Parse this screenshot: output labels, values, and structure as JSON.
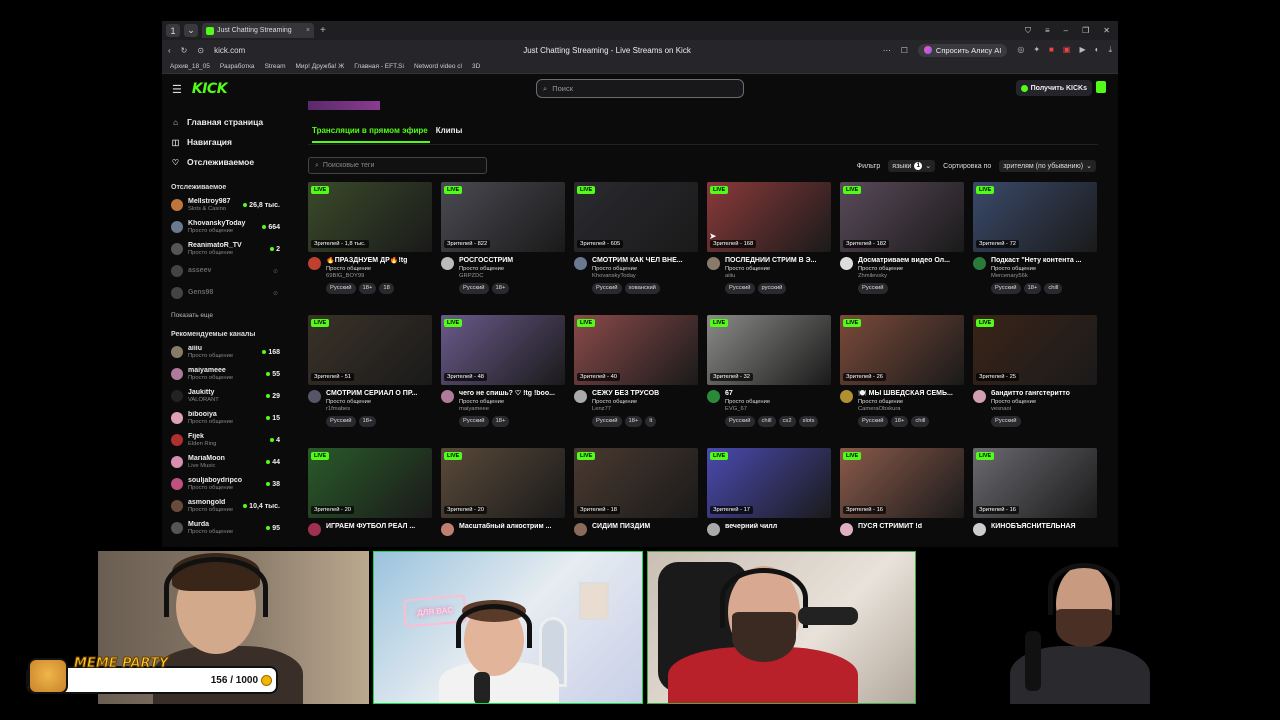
{
  "browser": {
    "tab_title": "Just Chatting Streaming",
    "url": "kick.com",
    "page_title": "Just Chatting Streaming - Live Streams on Kick",
    "alice_label": "Спросить Алису AI",
    "bookmarks": [
      "Архив_18_05",
      "Разработка",
      "Stream",
      "Мир! Дружба! Ж",
      "Главная - EFT.Si",
      "Netword video cl",
      "3D"
    ]
  },
  "kick": {
    "logo": "KICK",
    "search_placeholder": "Поиск",
    "get_kicks": "Получить KICKs",
    "nav": [
      {
        "label": "Главная страница",
        "icon": "home-icon"
      },
      {
        "label": "Навигация",
        "icon": "compass-icon"
      },
      {
        "label": "Отслеживаемое",
        "icon": "heart-icon"
      }
    ],
    "following_heading": "Отслеживаемое",
    "following": [
      {
        "name": "Mellstroy987",
        "category": "Slots & Casino",
        "count": "26,8 тыс.",
        "color": "#c0763a"
      },
      {
        "name": "KhovanskyToday",
        "category": "Просто общение",
        "count": "664",
        "color": "#6a7890"
      },
      {
        "name": "ReanimatoR_TV",
        "category": "Просто общение",
        "count": "2",
        "color": "#555"
      }
    ],
    "following_offline": [
      {
        "name": "asseev",
        "color": "#444"
      },
      {
        "name": "Gens98",
        "color": "#444"
      }
    ],
    "show_more": "Показать еще",
    "recommended_heading": "Рекомендуемые каналы",
    "recommended": [
      {
        "name": "aiiiu",
        "category": "Просто общение",
        "count": "168",
        "color": "#8a7a6a"
      },
      {
        "name": "maiyameee",
        "category": "Просто общение",
        "count": "55",
        "color": "#b07a9a"
      },
      {
        "name": "Jaukitty",
        "category": "VALORANT",
        "count": "29",
        "color": "#222"
      },
      {
        "name": "bibooiya",
        "category": "Просто общение",
        "count": "15",
        "color": "#e0a0b8"
      },
      {
        "name": "Fijek",
        "category": "Elden Ring",
        "count": "4",
        "color": "#b03030"
      },
      {
        "name": "MariaMoon",
        "category": "Live Music",
        "count": "44",
        "color": "#d890b0"
      },
      {
        "name": "souljaboydripco",
        "category": "Просто общение",
        "count": "38",
        "color": "#c05080"
      },
      {
        "name": "asmongold",
        "category": "Просто общение",
        "count": "10,4 тыс.",
        "color": "#6a4a3a"
      },
      {
        "name": "Murda",
        "category": "Просто общение",
        "count": "95",
        "color": "#555"
      }
    ],
    "tabs": {
      "live": "Трансляции в прямом эфире",
      "clips": "Клипы"
    },
    "tag_search_placeholder": "Поисковые теги",
    "filter_label": "Фильтр",
    "languages_label": "языки",
    "languages_count": "1",
    "sort_label": "Сортировка по",
    "sort_value": "зрителям (по убыванию)",
    "live_badge": "LIVE",
    "streams": [
      {
        "viewers": "Зрителей - 1,8 тыс.",
        "title": "🔥ПРАЗДНУЕМ ДР🔥!tg",
        "category": "Просто общение",
        "user": "69BIG_BOY99",
        "tags": [
          "Русский",
          "18+",
          "18"
        ],
        "bg": "#3a4a2a",
        "av": "#c04030"
      },
      {
        "viewers": "Зрителей - 822",
        "title": "РОСГОССТРИМ",
        "category": "Просто общение",
        "user": "GRPZDC",
        "tags": [
          "Русский",
          "18+"
        ],
        "bg": "#4a4a52",
        "av": "#bbb"
      },
      {
        "viewers": "Зрителей - 605",
        "title": "СМОТРИМ КАК ЧЕЛ ВНЕ...",
        "category": "Просто общение",
        "user": "KhovanskyToday",
        "tags": [
          "Русский",
          "хованский"
        ],
        "bg": "#2a2a30",
        "av": "#6a7890"
      },
      {
        "viewers": "Зрителей - 168",
        "title": "ПОСЛЕДНИЙ СТРИМ В Э...",
        "category": "Просто общение",
        "user": "aiiiu",
        "tags": [
          "Русский",
          "русский"
        ],
        "bg": "#8a3a3a",
        "av": "#8a7a6a"
      },
      {
        "viewers": "Зрителей - 182",
        "title": "Досматриваем видео Ол...",
        "category": "Просто общение",
        "user": "Zhmilevsky",
        "tags": [
          "Русский"
        ],
        "bg": "#5a4a5a",
        "av": "#ddd"
      },
      {
        "viewers": "Зрителей - 72",
        "title": "Подкаст \"Нету контента ...",
        "category": "Просто общение",
        "user": "Mercenary56k",
        "tags": [
          "Русский",
          "18+",
          "chill"
        ],
        "bg": "#3a4a6a",
        "av": "#2a7a3a"
      },
      {
        "viewers": "Зрителей - 51",
        "title": "СМОТРИМ СЕРИАЛ О ПР...",
        "category": "Просто общение",
        "user": "r1fmabes",
        "tags": [
          "Русский",
          "18+"
        ],
        "bg": "#3a3228",
        "av": "#556"
      },
      {
        "viewers": "Зрителей - 48",
        "title": "чего не спишь? ♡ !tg !boo...",
        "category": "Просто общение",
        "user": "maiyameee",
        "tags": [
          "Русский",
          "18+"
        ],
        "bg": "#6a5a8a",
        "av": "#b07a9a"
      },
      {
        "viewers": "Зрителей - 40",
        "title": "СЕЖУ БЕЗ ТРУСОВ",
        "category": "Просто общение",
        "user": "Lenz77",
        "tags": [
          "Русский",
          "18+",
          "lt"
        ],
        "bg": "#8a4a4a",
        "av": "#aaa"
      },
      {
        "viewers": "Зрителей - 32",
        "title": "67",
        "category": "Просто общение",
        "user": "EVG_67",
        "tags": [
          "Русский",
          "chill",
          "cs2",
          "slots"
        ],
        "bg": "#8a8a88",
        "av": "#2a8a3a"
      },
      {
        "viewers": "Зрителей - 26",
        "title": "🍽️ МЫ ШВЕДСКАЯ СЕМЬ...",
        "category": "Просто общение",
        "user": "CameraObskura",
        "tags": [
          "Русский",
          "18+",
          "chill"
        ],
        "bg": "#7a4a3a",
        "av": "#b09030"
      },
      {
        "viewers": "Зрителей - 25",
        "title": "бандитто гангстеритто",
        "category": "Просто общение",
        "user": "vesnaoi",
        "tags": [
          "Русский"
        ],
        "bg": "#3a2418",
        "av": "#d0a0b0"
      },
      {
        "viewers": "Зрителей - 20",
        "title": "ИГРАЕМ ФУТБОЛ РЕАЛ ...",
        "category": "",
        "user": "",
        "tags": [],
        "bg": "#2a5a2a",
        "av": "#a03050"
      },
      {
        "viewers": "Зрителей - 20",
        "title": "Масштабный алкострим ...",
        "category": "",
        "user": "",
        "tags": [],
        "bg": "#5a4a3a",
        "av": "#c08070"
      },
      {
        "viewers": "Зрителей - 18",
        "title": "СИДИМ ПИЗДИМ",
        "category": "",
        "user": "",
        "tags": [],
        "bg": "#4a3a30",
        "av": "#8a6a5a"
      },
      {
        "viewers": "Зрителей - 17",
        "title": "вечерний чилл",
        "category": "",
        "user": "",
        "tags": [],
        "bg": "#4a4ab0",
        "av": "#aaa"
      },
      {
        "viewers": "Зрителей - 16",
        "title": "ПУСЯ СТРИМИТ !d",
        "category": "",
        "user": "",
        "tags": [],
        "bg": "#8a5a4a",
        "av": "#e0b0c0"
      },
      {
        "viewers": "Зрителей - 16",
        "title": "КИНОБЪЯСНИТЕЛЬНАЯ",
        "category": "",
        "user": "",
        "tags": [],
        "bg": "#6a6a70",
        "av": "#ccc"
      }
    ]
  },
  "overlay": {
    "neon_sign": "ДЛЯ ВАС",
    "meme_title": "MEME PARTY",
    "meme_progress": "156 / 1000"
  }
}
